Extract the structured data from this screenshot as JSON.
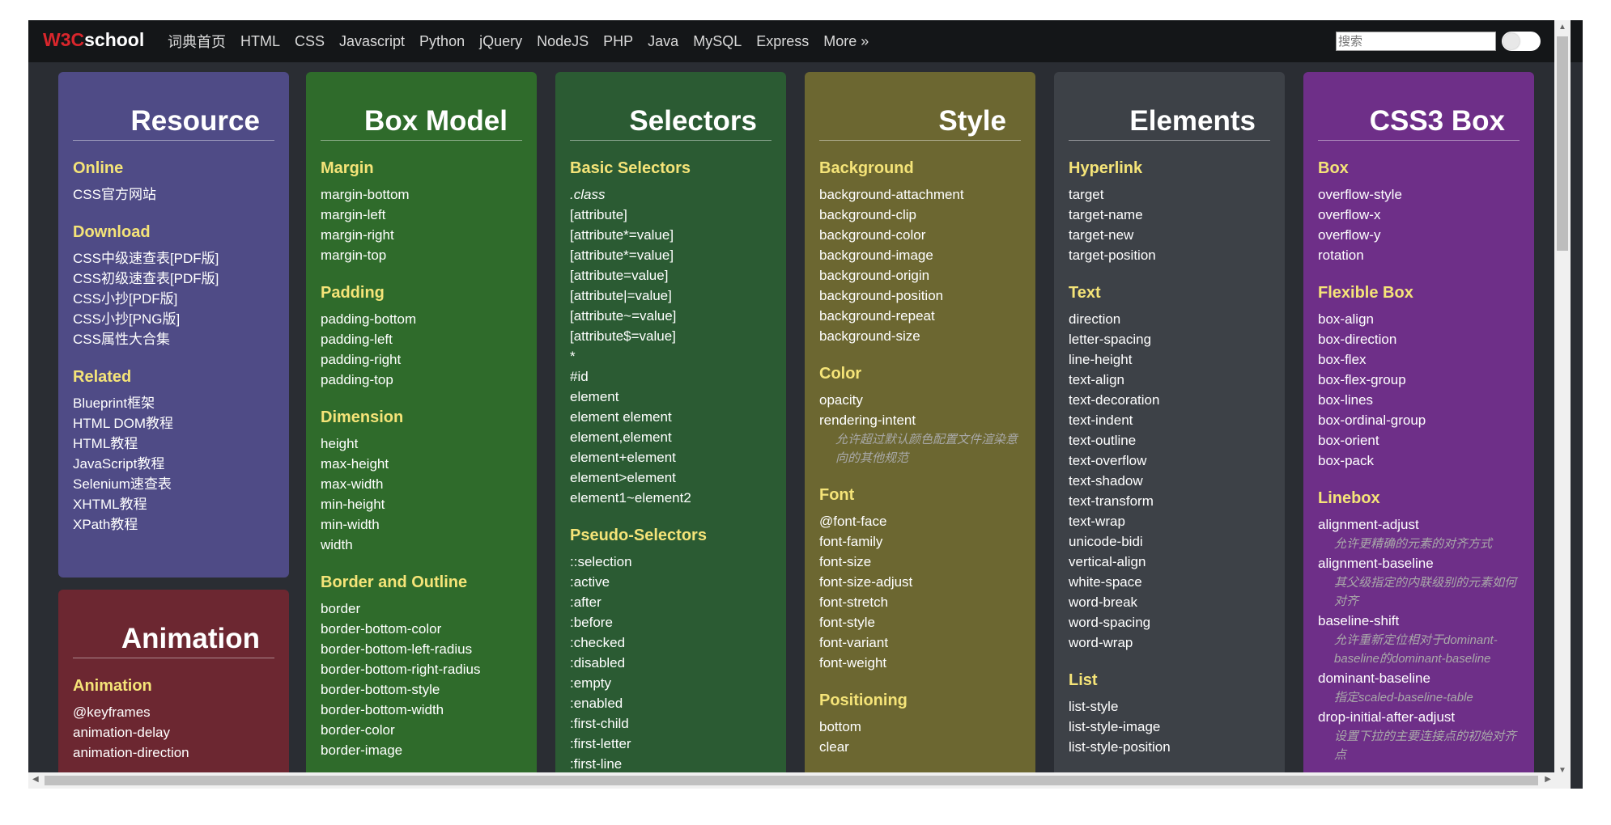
{
  "header": {
    "logo_w3c": "W3C",
    "logo_school": "school",
    "nav": [
      "词典首页",
      "HTML",
      "CSS",
      "Javascript",
      "Python",
      "jQuery",
      "NodeJS",
      "PHP",
      "Java",
      "MySQL",
      "Express",
      "More »"
    ],
    "search_placeholder": "搜索"
  },
  "cards": {
    "resource": {
      "title": "Resource",
      "sections": [
        {
          "heading": "Online",
          "items": [
            {
              "text": "CSS官方网站"
            }
          ]
        },
        {
          "heading": "Download",
          "items": [
            {
              "text": "CSS中级速查表[PDF版]"
            },
            {
              "text": "CSS初级速查表[PDF版]"
            },
            {
              "text": "CSS小抄[PDF版]"
            },
            {
              "text": "CSS小抄[PNG版]"
            },
            {
              "text": "CSS属性大合集"
            }
          ]
        },
        {
          "heading": "Related",
          "items": [
            {
              "text": "Blueprint框架"
            },
            {
              "text": "HTML DOM教程"
            },
            {
              "text": "HTML教程"
            },
            {
              "text": "JavaScript教程"
            },
            {
              "text": "Selenium速查表"
            },
            {
              "text": "XHTML教程"
            },
            {
              "text": "XPath教程"
            }
          ]
        }
      ]
    },
    "animation": {
      "title": "Animation",
      "sections": [
        {
          "heading": "Animation",
          "items": [
            {
              "text": "@keyframes"
            },
            {
              "text": "animation-delay"
            },
            {
              "text": "animation-direction"
            }
          ]
        }
      ]
    },
    "boxmodel": {
      "title": "Box Model",
      "sections": [
        {
          "heading": "Margin",
          "items": [
            {
              "text": "margin-bottom"
            },
            {
              "text": "margin-left"
            },
            {
              "text": "margin-right"
            },
            {
              "text": "margin-top"
            }
          ]
        },
        {
          "heading": "Padding",
          "items": [
            {
              "text": "padding-bottom"
            },
            {
              "text": "padding-left"
            },
            {
              "text": "padding-right"
            },
            {
              "text": "padding-top"
            }
          ]
        },
        {
          "heading": "Dimension",
          "items": [
            {
              "text": "height"
            },
            {
              "text": "max-height"
            },
            {
              "text": "max-width"
            },
            {
              "text": "min-height"
            },
            {
              "text": "min-width"
            },
            {
              "text": "width"
            }
          ]
        },
        {
          "heading": "Border and Outline",
          "items": [
            {
              "text": "border"
            },
            {
              "text": "border-bottom-color"
            },
            {
              "text": "border-bottom-left-radius"
            },
            {
              "text": "border-bottom-right-radius"
            },
            {
              "text": "border-bottom-style"
            },
            {
              "text": "border-bottom-width"
            },
            {
              "text": "border-color"
            },
            {
              "text": "border-image"
            }
          ]
        }
      ]
    },
    "selectors": {
      "title": "Selectors",
      "sections": [
        {
          "heading": "Basic Selectors",
          "items": [
            {
              "text": ".class",
              "italic": true
            },
            {
              "text": "[attribute]"
            },
            {
              "text": "[attribute*=value]"
            },
            {
              "text": "[attribute*=value]"
            },
            {
              "text": "[attribute=value]"
            },
            {
              "text": "[attribute|=value]"
            },
            {
              "text": "[attribute~=value]"
            },
            {
              "text": "[attribute$=value]"
            },
            {
              "text": "*"
            },
            {
              "text": "#id"
            },
            {
              "text": "element"
            },
            {
              "text": "element element"
            },
            {
              "text": "element,element"
            },
            {
              "text": "element+element"
            },
            {
              "text": "element>element"
            },
            {
              "text": "element1~element2"
            }
          ]
        },
        {
          "heading": "Pseudo-Selectors",
          "items": [
            {
              "text": "::selection"
            },
            {
              "text": ":active"
            },
            {
              "text": ":after"
            },
            {
              "text": ":before"
            },
            {
              "text": ":checked"
            },
            {
              "text": ":disabled"
            },
            {
              "text": ":empty"
            },
            {
              "text": ":enabled"
            },
            {
              "text": ":first-child"
            },
            {
              "text": ":first-letter"
            },
            {
              "text": ":first-line"
            }
          ]
        }
      ]
    },
    "style": {
      "title": "Style",
      "sections": [
        {
          "heading": "Background",
          "items": [
            {
              "text": "background-attachment"
            },
            {
              "text": "background-clip"
            },
            {
              "text": "background-color"
            },
            {
              "text": "background-image"
            },
            {
              "text": "background-origin"
            },
            {
              "text": "background-position"
            },
            {
              "text": "background-repeat"
            },
            {
              "text": "background-size"
            }
          ]
        },
        {
          "heading": "Color",
          "items": [
            {
              "text": "opacity"
            },
            {
              "text": "rendering-intent"
            },
            {
              "text": "允许超过默认颜色配置文件渲染意向的其他规范",
              "note": true
            }
          ]
        },
        {
          "heading": "Font",
          "items": [
            {
              "text": "@font-face"
            },
            {
              "text": "font-family"
            },
            {
              "text": "font-size"
            },
            {
              "text": "font-size-adjust"
            },
            {
              "text": "font-stretch"
            },
            {
              "text": "font-style"
            },
            {
              "text": "font-variant"
            },
            {
              "text": "font-weight"
            }
          ]
        },
        {
          "heading": "Positioning",
          "items": [
            {
              "text": "bottom"
            },
            {
              "text": "clear"
            }
          ]
        }
      ]
    },
    "elements": {
      "title": "Elements",
      "sections": [
        {
          "heading": "Hyperlink",
          "items": [
            {
              "text": "target"
            },
            {
              "text": "target-name"
            },
            {
              "text": "target-new"
            },
            {
              "text": "target-position"
            }
          ]
        },
        {
          "heading": "Text",
          "items": [
            {
              "text": "direction"
            },
            {
              "text": "letter-spacing"
            },
            {
              "text": "line-height"
            },
            {
              "text": "text-align"
            },
            {
              "text": "text-decoration"
            },
            {
              "text": "text-indent"
            },
            {
              "text": "text-outline"
            },
            {
              "text": "text-overflow"
            },
            {
              "text": "text-shadow"
            },
            {
              "text": "text-transform"
            },
            {
              "text": "text-wrap"
            },
            {
              "text": "unicode-bidi"
            },
            {
              "text": "vertical-align"
            },
            {
              "text": "white-space"
            },
            {
              "text": "word-break"
            },
            {
              "text": "word-spacing"
            },
            {
              "text": "word-wrap"
            }
          ]
        },
        {
          "heading": "List",
          "items": [
            {
              "text": "list-style"
            },
            {
              "text": "list-style-image"
            },
            {
              "text": "list-style-position"
            }
          ]
        }
      ]
    },
    "css3box": {
      "title": "CSS3 Box",
      "sections": [
        {
          "heading": "Box",
          "items": [
            {
              "text": "overflow-style"
            },
            {
              "text": "overflow-x"
            },
            {
              "text": "overflow-y"
            },
            {
              "text": "rotation"
            }
          ]
        },
        {
          "heading": "Flexible Box",
          "items": [
            {
              "text": "box-align"
            },
            {
              "text": "box-direction"
            },
            {
              "text": "box-flex"
            },
            {
              "text": "box-flex-group"
            },
            {
              "text": "box-lines"
            },
            {
              "text": "box-ordinal-group"
            },
            {
              "text": "box-orient"
            },
            {
              "text": "box-pack"
            }
          ]
        },
        {
          "heading": "Linebox",
          "items": [
            {
              "text": "alignment-adjust"
            },
            {
              "text": "允许更精确的元素的对齐方式",
              "note": true
            },
            {
              "text": "alignment-baseline"
            },
            {
              "text": "其父级指定的内联级别的元素如何对齐",
              "note": true
            },
            {
              "text": "baseline-shift"
            },
            {
              "text": "允许重新定位相对于dominant-baseline的dominant-baseline",
              "note": true
            },
            {
              "text": "dominant-baseline"
            },
            {
              "text": "指定scaled-baseline-table",
              "note": true
            },
            {
              "text": "drop-initial-after-adjust"
            },
            {
              "text": "设置下拉的主要连接点的初始对齐点",
              "note": true
            }
          ]
        }
      ]
    }
  }
}
